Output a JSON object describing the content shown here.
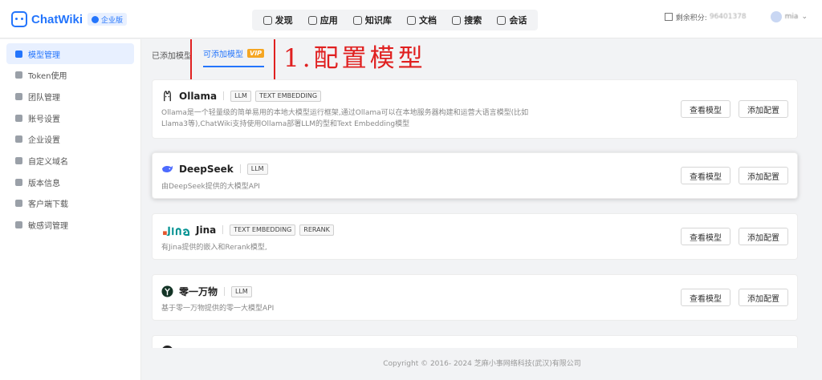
{
  "app": {
    "name": "ChatWiki",
    "edition": "企业版"
  },
  "topnav": [
    {
      "label": "发现",
      "icon": "discover-icon"
    },
    {
      "label": "应用",
      "icon": "robot-icon"
    },
    {
      "label": "知识库",
      "icon": "book-icon"
    },
    {
      "label": "文档",
      "icon": "document-icon"
    },
    {
      "label": "搜索",
      "icon": "search-icon"
    },
    {
      "label": "会话",
      "icon": "chat-icon"
    }
  ],
  "header": {
    "points_label": "剩余积分:",
    "points_value": "96401378",
    "username": "mia"
  },
  "sidebar": {
    "items": [
      {
        "label": "模型管理",
        "active": true
      },
      {
        "label": "Token使用"
      },
      {
        "label": "团队管理"
      },
      {
        "label": "账号设置"
      },
      {
        "label": "企业设置"
      },
      {
        "label": "自定义域名"
      },
      {
        "label": "版本信息"
      },
      {
        "label": "客户端下载"
      },
      {
        "label": "敏感词管理"
      }
    ]
  },
  "tabs": {
    "added": "已添加模型",
    "available": "可添加模型",
    "vip": "VIP"
  },
  "annotation": "1.配置模型",
  "buttons": {
    "view": "查看模型",
    "add": "添加配置"
  },
  "models": [
    {
      "name": "Ollama",
      "tags": [
        "LLM",
        "TEXT EMBEDDING"
      ],
      "desc": "Ollama是一个轻量级的简单易用的本地大模型运行框架,通过Ollama可以在本地服务器构建和运营大语言模型(比如Llama3等),ChatWiki支持使用Ollama部署LLM的型和Text Embedding模型",
      "color": "#222222"
    },
    {
      "name": "DeepSeek",
      "tags": [
        "LLM"
      ],
      "desc": "由DeepSeek提供的大模型API",
      "color": "#4d6bfe"
    },
    {
      "name": "Jina",
      "tags": [
        "TEXT EMBEDDING",
        "RERANK"
      ],
      "desc": "有Jina提供的嵌入和Rerank模型,",
      "color": "#009191"
    },
    {
      "name": "零一万物",
      "tags": [
        "LLM"
      ],
      "desc": "基于零一万物提供的零一大模型API",
      "color": "#133426"
    },
    {
      "name": "",
      "tags": [],
      "desc": "",
      "color": "#222222"
    }
  ],
  "footer": "Copyright © 2016- 2024 芝麻小事网络科技(武汉)有限公司"
}
